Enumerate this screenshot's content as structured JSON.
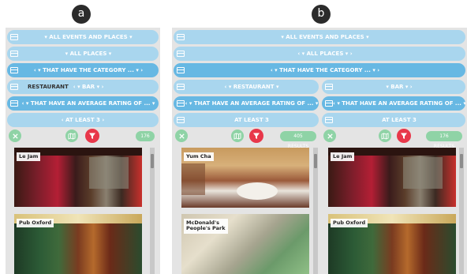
{
  "labels": {
    "a": "a",
    "b": "b"
  },
  "panel_a": {
    "rows": {
      "all_events": "▾ ALL EVENTS AND PLACES ▾",
      "all_places": "▾ ALL PLACES ▾",
      "category": "‹ ▾ THAT HAVE THE CATEGORY ... ▾ ›",
      "restaurant": "RESTAURANT",
      "bar": "‹ ▾ BAR ▾ ›",
      "rating": "‹ ▾ THAT HAVE AN AVERAGE RATING OF ... ▾",
      "at_least": "‹ AT LEAST 3 ›"
    },
    "count": "176",
    "cards": [
      "Le Jam",
      "Pub Oxford"
    ]
  },
  "panel_b": {
    "rows": {
      "all_events": "▾ ALL EVENTS AND PLACES ▾",
      "all_places": "‹ ▾ ALL PLACES ▾ ›",
      "category": "‹ ▾ THAT HAVE THE CATEGORY ... ▾ ›",
      "restaurant": "‹ ▾ RESTAURANT ▾",
      "bar": "▾ BAR ▾ ›",
      "rating_left": "‹ ▾ THAT HAVE AN AVERAGE RATING OF ... ▾",
      "rating_right": "‹ ▾ THAT HAVE AN AVERAGE RATING OF ... ▾",
      "at_least_left": "AT LEAST 3",
      "at_least_right": "AT LEAST 3"
    },
    "results_left": "405 RESULTS",
    "results_right": "176 RESULTS",
    "cards_left": [
      "Yum Cha",
      "McDonald's\nPeople's Park"
    ],
    "cards_right": [
      "Le Jam",
      "Pub Oxford"
    ]
  },
  "colors": {
    "light_blue": "#a9d6ee",
    "dark_blue": "#67b8e3",
    "green": "#8fd3a6",
    "red": "#e8374a"
  },
  "icons": [
    "table-icon",
    "close-icon",
    "map-icon",
    "filter-icon"
  ]
}
